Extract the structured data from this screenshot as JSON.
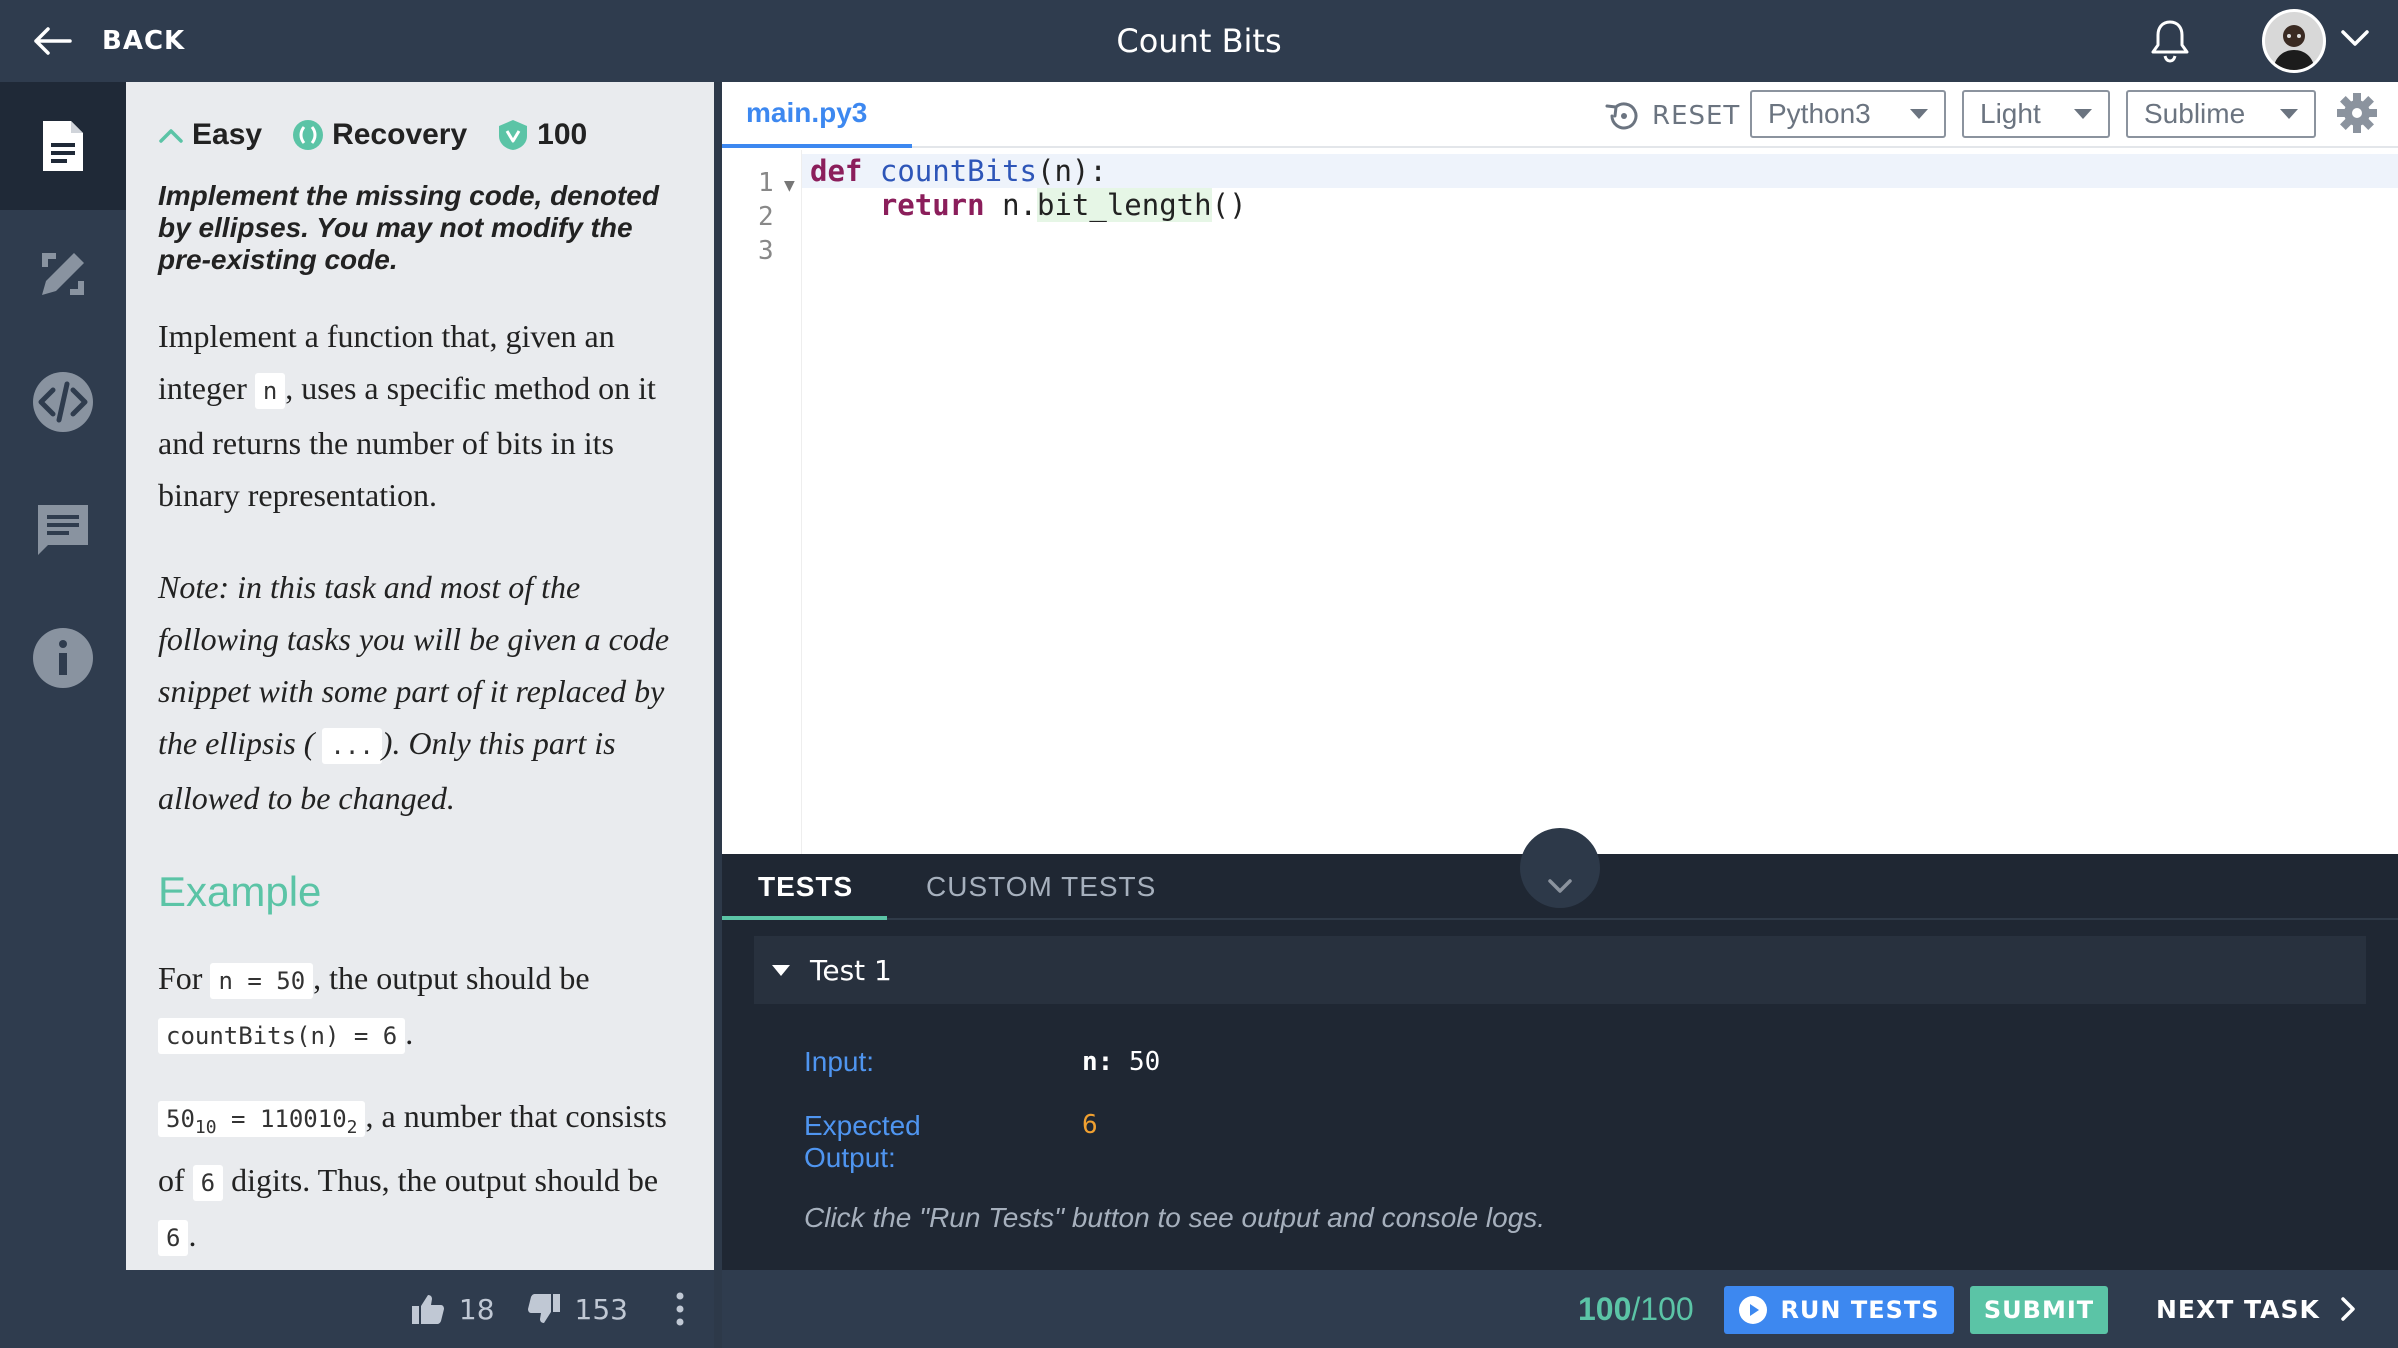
{
  "header": {
    "back_label": "BACK",
    "title": "Count Bits"
  },
  "rail": {
    "items": [
      {
        "icon": "description-icon",
        "active": true
      },
      {
        "icon": "solutions-icon",
        "active": false
      },
      {
        "icon": "code-icon",
        "active": false
      },
      {
        "icon": "comments-icon",
        "active": false
      },
      {
        "icon": "info-icon",
        "active": false
      }
    ]
  },
  "task": {
    "difficulty": "Easy",
    "category": "Recovery",
    "points": "100",
    "instructions": "Implement the missing code, denoted by ellipses. You may not modify the pre-existing code.",
    "p1_a": "Implement a function that, given an integer",
    "p1_code": "n",
    "p1_b": ", uses a specific method on it and returns the number of bits in its binary representation.",
    "note_a": "Note: in this task and most of the following tasks you will be given a code snippet with some part of it replaced by the ellipsis (",
    "note_code": "...",
    "note_b": "). Only this part is allowed to be changed.",
    "example_heading": "Example",
    "ex1_a": "For",
    "ex1_code": "n = 50",
    "ex1_b": ", the output should be",
    "ex1_code2": "countBits(n) = 6",
    "ex1_end": ".",
    "ex2_code_a": "50",
    "ex2_sub_a": "10",
    "ex2_code_b": " = 110010",
    "ex2_sub_b": "2",
    "ex2_a": ", a number that consists of",
    "ex2_code2": "6",
    "ex2_b": "digits. Thus, the output should be",
    "ex2_code3": "6",
    "ex2_end": "."
  },
  "votes": {
    "up": "18",
    "down": "153"
  },
  "editor": {
    "file_tab": "main.py3",
    "reset_label": "RESET",
    "language": "Python3",
    "theme": "Light",
    "keymap": "Sublime",
    "line_numbers": [
      "1",
      "2",
      "3"
    ],
    "code": {
      "l1_kw": "def",
      "l1_fn": "countBits",
      "l1_rest": "(n):",
      "l2_kw": "return",
      "l2_a": "n.",
      "l2_b": "bit_length",
      "l2_c": "()"
    }
  },
  "tests": {
    "tab_tests": "TESTS",
    "tab_custom": "CUSTOM TESTS",
    "test_name": "Test 1",
    "input_label": "Input:",
    "input_key": "n:",
    "input_value": "50",
    "expected_label_1": "Expected",
    "expected_label_2": "Output:",
    "expected_value": "6",
    "hint": "Click the \"Run Tests\" button to see output and console logs."
  },
  "footer": {
    "score": "100",
    "score_total": "/100",
    "run_tests_label": "RUN TESTS",
    "submit_label": "SUBMIT",
    "next_task_label": "NEXT TASK"
  },
  "colors": {
    "accent_blue": "#3d88f0",
    "accent_green": "#5bc4a6",
    "orange": "#f0a030",
    "nav_bg": "#2f3c4e"
  }
}
